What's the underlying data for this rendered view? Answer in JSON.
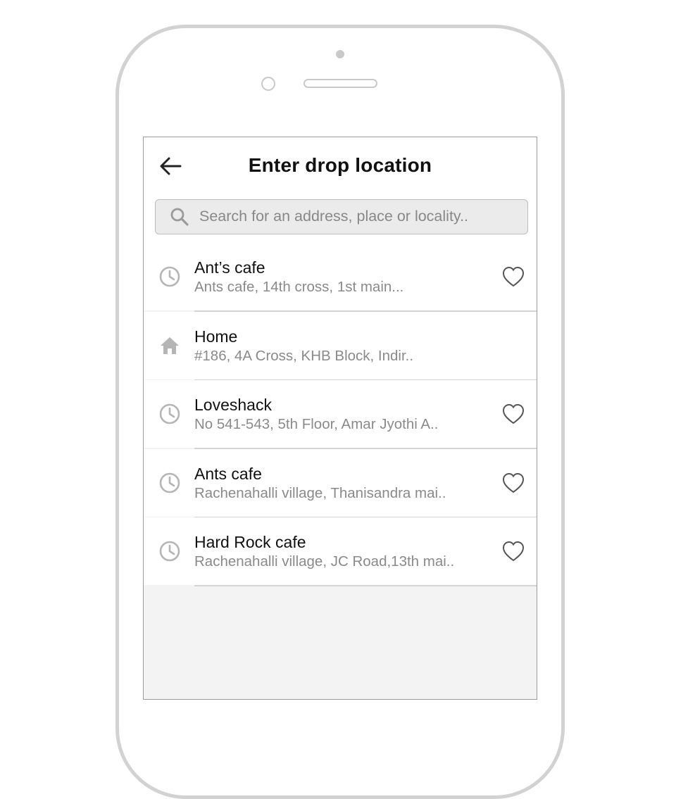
{
  "header": {
    "title": "Enter drop location",
    "back_icon": "arrow-left-icon"
  },
  "search": {
    "placeholder": "Search for an address, place or locality..",
    "value": "",
    "icon": "search-icon"
  },
  "colors": {
    "frame": "#d2d2d2",
    "icon_gray": "#b5b5b5",
    "subtitle": "#8a8a8a",
    "background": "#f3f3f3"
  },
  "locations": [
    {
      "title": "Ant’s cafe",
      "subtitle": "Ants cafe, 14th cross, 1st main...",
      "icon": "clock-icon",
      "favorite": true
    },
    {
      "title": "Home",
      "subtitle": "#186, 4A Cross, KHB Block, Indir..",
      "icon": "home-icon",
      "favorite": false
    },
    {
      "title": "Loveshack",
      "subtitle": "No 541-543, 5th Floor, Amar Jyothi A..",
      "icon": "clock-icon",
      "favorite": true
    },
    {
      "title": "Ants cafe",
      "subtitle": "Rachenahalli village, Thanisandra mai..",
      "icon": "clock-icon",
      "favorite": true
    },
    {
      "title": "Hard Rock cafe",
      "subtitle": "Rachenahalli village, JC Road,13th mai..",
      "icon": "clock-icon",
      "favorite": true
    }
  ]
}
